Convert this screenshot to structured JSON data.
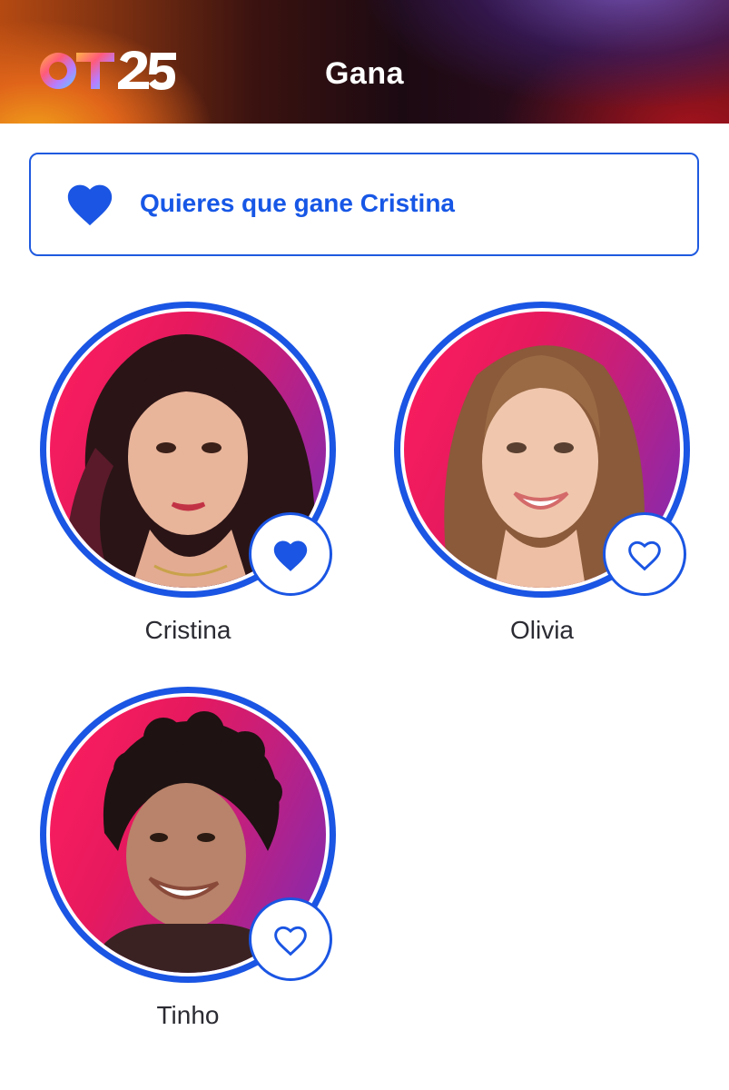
{
  "header": {
    "logo_text": "OT25",
    "title": "Gana"
  },
  "banner": {
    "icon": "heart-filled-icon",
    "text": "Quieres que gane Cristina"
  },
  "candidates": [
    {
      "name": "Cristina",
      "selected": true,
      "icon": "heart-filled-icon"
    },
    {
      "name": "Olivia",
      "selected": false,
      "icon": "heart-outline-icon"
    },
    {
      "name": "Tinho",
      "selected": false,
      "icon": "heart-outline-icon"
    }
  ],
  "colors": {
    "accent": "#1a55e3",
    "banner_text": "#1757e6",
    "photo_bg_pink": "#e7195e",
    "photo_bg_purple": "#7b2bb8"
  }
}
